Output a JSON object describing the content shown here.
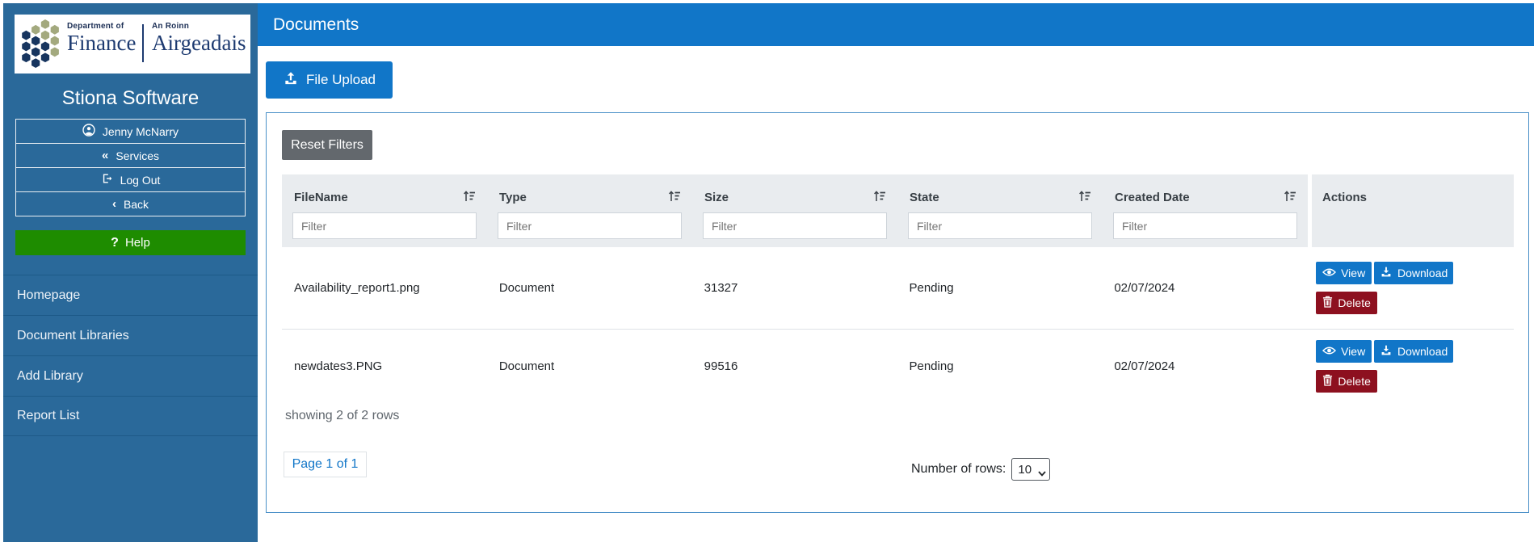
{
  "logo": {
    "department_of": "Department of",
    "finance": "Finance",
    "an_roinn": "An Roinn",
    "airgeadais": "Airgeadais"
  },
  "sidebar": {
    "title": "Stiona Software",
    "buttons": [
      {
        "label": "Jenny McNarry",
        "icon": "user-circle-icon"
      },
      {
        "label": "Services",
        "icon": "double-chevron-left-icon",
        "glyph": "«"
      },
      {
        "label": "Log Out",
        "icon": "logout-icon"
      },
      {
        "label": "Back",
        "icon": "chevron-left-icon",
        "glyph": "‹"
      }
    ],
    "help_label": "Help",
    "help_glyph": "?",
    "nav": [
      {
        "label": "Homepage"
      },
      {
        "label": "Document Libraries"
      },
      {
        "label": "Add Library"
      },
      {
        "label": "Report List"
      }
    ]
  },
  "header": {
    "title": "Documents"
  },
  "toolbar": {
    "file_upload_label": "File Upload",
    "reset_filters_label": "Reset Filters"
  },
  "table": {
    "columns": [
      {
        "label": "FileName",
        "filter_placeholder": "Filter"
      },
      {
        "label": "Type",
        "filter_placeholder": "Filter"
      },
      {
        "label": "Size",
        "filter_placeholder": "Filter"
      },
      {
        "label": "State",
        "filter_placeholder": "Filter"
      },
      {
        "label": "Created Date",
        "filter_placeholder": "Filter"
      }
    ],
    "actions_label": "Actions",
    "action_buttons": {
      "view": "View",
      "download": "Download",
      "delete": "Delete"
    },
    "rows": [
      {
        "file_name": "Availability_report1.png",
        "type": "Document",
        "size": "31327",
        "state": "Pending",
        "created_date": "02/07/2024"
      },
      {
        "file_name": "newdates3.PNG",
        "type": "Document",
        "size": "99516",
        "state": "Pending",
        "created_date": "02/07/2024"
      }
    ],
    "summary": "showing 2 of 2 rows"
  },
  "pagination": {
    "page_label": "Page 1 of 1",
    "rows_count_label": "Number of rows:",
    "rows_selected": "10"
  },
  "colors": {
    "header_blue": "#1176c8",
    "sidebar_blue": "#2a699a",
    "help_green": "#1e8c00",
    "delete_red": "#8d101f",
    "table_header_gray": "#e9ecef",
    "logo_navy": "#1d3a70",
    "logo_olive": "#a3a97e"
  }
}
